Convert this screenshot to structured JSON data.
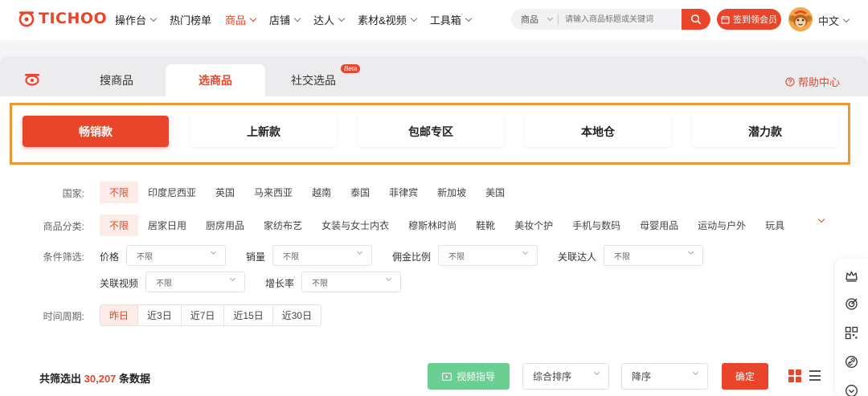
{
  "brand": {
    "name": "TICHOO",
    "accent": "#e8452a",
    "highlight_border": "#f0962e"
  },
  "nav": {
    "items": [
      {
        "label": "操作台",
        "dropdown": true,
        "active": false
      },
      {
        "label": "热门榜单",
        "dropdown": false,
        "active": false
      },
      {
        "label": "商品",
        "dropdown": true,
        "active": true
      },
      {
        "label": "店铺",
        "dropdown": true,
        "active": false
      },
      {
        "label": "达人",
        "dropdown": true,
        "active": false
      },
      {
        "label": "素材&视频",
        "dropdown": true,
        "active": false
      },
      {
        "label": "工具箱",
        "dropdown": true,
        "active": false
      }
    ],
    "search_type": "商品",
    "search_placeholder": "请输入商品标题或关键词",
    "vip_label": "签到领会员",
    "language": "中文"
  },
  "tabs": {
    "items": [
      "搜商品",
      "选商品",
      "社交选品"
    ],
    "active_index": 1,
    "beta_badge": "Beta",
    "help_label": "帮助中心"
  },
  "categories": {
    "items": [
      "畅销款",
      "上新款",
      "包邮专区",
      "本地仓",
      "潜力款"
    ],
    "active_index": 0
  },
  "filters": {
    "country": {
      "label": "国家:",
      "options": [
        "不限",
        "印度尼西亚",
        "英国",
        "马来西亚",
        "越南",
        "泰国",
        "菲律宾",
        "新加坡",
        "美国"
      ],
      "active_index": 0
    },
    "product_category": {
      "label": "商品分类:",
      "options": [
        "不限",
        "居家日用",
        "厨房用品",
        "家纺布艺",
        "女装与女士内衣",
        "穆斯林时尚",
        "鞋靴",
        "美妆个护",
        "手机与数码",
        "母婴用品",
        "运动与户外",
        "玩具"
      ],
      "active_index": 0
    },
    "conditions": {
      "label": "条件筛选:",
      "fields": [
        {
          "label": "价格",
          "value": "不限"
        },
        {
          "label": "销量",
          "value": "不限"
        },
        {
          "label": "佣金比例",
          "value": "不限"
        },
        {
          "label": "关联达人",
          "value": "不限"
        },
        {
          "label": "关联视频",
          "value": "不限"
        },
        {
          "label": "增长率",
          "value": "不限"
        }
      ]
    },
    "period": {
      "label": "时间周期:",
      "options": [
        "昨日",
        "近3日",
        "近7日",
        "近15日",
        "近30日"
      ],
      "active_index": 0
    }
  },
  "results": {
    "prefix": "共筛选出",
    "count": "30,207",
    "suffix": "条数据",
    "video_guide_label": "视频指导",
    "sort_by": "综合排序",
    "sort_order": "降序",
    "confirm_label": "确定"
  },
  "side_toolbar": {
    "icons": [
      "crown-icon",
      "target-icon",
      "qrcode-icon",
      "link-icon",
      "chevron-down-icon"
    ]
  }
}
